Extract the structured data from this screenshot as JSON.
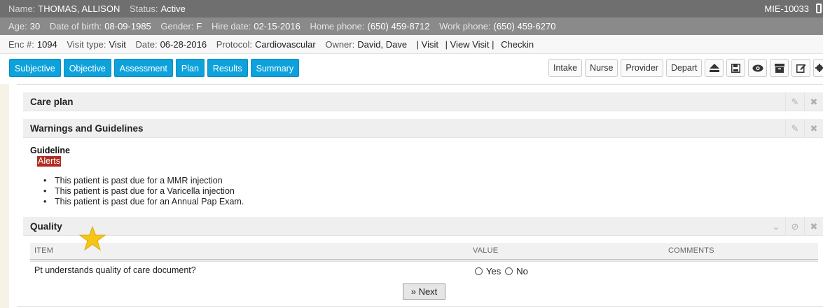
{
  "patient": {
    "name_label": "Name:",
    "name": "THOMAS, ALLISON",
    "status_label": "Status:",
    "status": "Active",
    "mrn": "MIE-10033",
    "age_label": "Age:",
    "age": "30",
    "dob_label": "Date of birth:",
    "dob": "08-09-1985",
    "gender_label": "Gender:",
    "gender": "F",
    "hire_label": "Hire date:",
    "hire": "02-15-2016",
    "home_label": "Home phone:",
    "home": "(650) 459-8712",
    "work_label": "Work phone:",
    "work": "(650) 459-6270"
  },
  "encounter": {
    "enc_label": "Enc #:",
    "enc": "1094",
    "visit_type_label": "Visit type:",
    "visit_type": "Visit",
    "date_label": "Date:",
    "date": "06-28-2016",
    "protocol_label": "Protocol:",
    "protocol": "Cardiovascular",
    "owner_label": "Owner:",
    "owner": "David, Dave",
    "links": [
      "| Visit",
      "| View Visit |",
      "Checkin"
    ]
  },
  "tabs": [
    "Subjective",
    "Objective",
    "Assessment",
    "Plan",
    "Results",
    "Summary"
  ],
  "right_buttons": [
    "Intake",
    "Nurse",
    "Provider",
    "Depart"
  ],
  "right_icons": [
    "eject-icon",
    "save-icon",
    "eye-icon",
    "archive-icon",
    "edit-icon",
    "gear-icon"
  ],
  "sections": {
    "care_plan": "Care plan",
    "warnings": "Warnings and Guidelines",
    "quality": "Quality"
  },
  "guideline": {
    "title": "Guideline",
    "badge": "Alerts",
    "items": [
      "This patient is past due for a MMR injection",
      "This patient is past due for a Varicella injection",
      "This patient is past due for an Annual Pap Exam."
    ]
  },
  "quality_table": {
    "columns": [
      "ITEM",
      "VALUE",
      "COMMENTS"
    ],
    "question": "Pt understands quality of care document?",
    "options": [
      "Yes",
      "No"
    ]
  },
  "next_label": "Next",
  "colors": {
    "tab_blue": "#0ea2dd",
    "alert_red": "#b22c21",
    "star_gold": "#f5c518"
  }
}
